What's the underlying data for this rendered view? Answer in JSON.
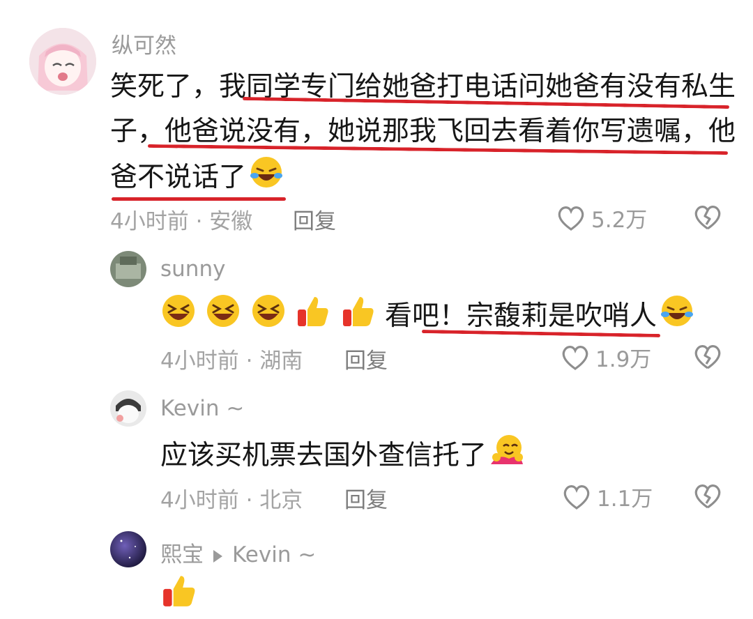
{
  "comments": [
    {
      "username": "纵可然",
      "lines": [
        "笑死了，我同学专门给她爸打电话问她爸有没有私生",
        "子，他爸说没有，她说那我飞回去看着你写遗嘱，他",
        "爸不说话了"
      ],
      "emoji": "laughing-tears-icon",
      "time_location": "4小时前 · 安徽",
      "reply_label": "回复",
      "likes": "5.2万"
    },
    {
      "username": "sunny",
      "text": "看吧！宗馥莉是吹哨人",
      "emojis": [
        "grinning-squint-icon",
        "grinning-squint-icon",
        "grinning-squint-icon",
        "thumbs-up-icon",
        "thumbs-up-icon"
      ],
      "time_location": "4小时前 · 湖南",
      "reply_label": "回复",
      "likes": "1.9万"
    },
    {
      "username": "Kevin ~",
      "text": "应该买机票去国外查信托了",
      "emoji": "hug-icon",
      "time_location": "4小时前 · 北京",
      "reply_label": "回复",
      "likes": "1.1万"
    },
    {
      "username": "熙宝",
      "reply_to": "Kevin ~",
      "emoji": "thumbs-up-icon"
    }
  ],
  "colors": {
    "highlight": "#d8232a",
    "meta": "#a3a3a3",
    "text": "#161616"
  }
}
